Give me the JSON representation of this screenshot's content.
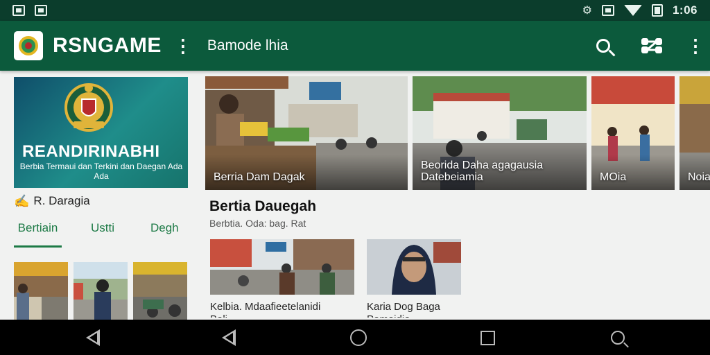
{
  "status_bar": {
    "time": "1:06",
    "left_icons": [
      "gallery-icon",
      "image-icon"
    ],
    "right_icons": [
      "settings-icon",
      "sim-icon",
      "wifi-icon",
      "battery-icon"
    ]
  },
  "app_bar": {
    "title": "RSNGAME",
    "subtitle": "Bamode lhia",
    "icons": [
      "app-logo-icon",
      "more-vert-icon",
      "search-icon",
      "share-icon",
      "more-vert-icon"
    ]
  },
  "sidebar": {
    "banner_title": "REANDIRINABHI",
    "banner_subtitle": "Berbia Termaui dan Terkini dan Daegan Ada Ada",
    "author": "R. Daragia",
    "tabs": [
      {
        "label": "Bertiain",
        "active": true
      },
      {
        "label": "Ustti",
        "active": false
      },
      {
        "label": "Degh",
        "active": false
      }
    ]
  },
  "carousel": [
    {
      "caption": "Berria Dam Dagak"
    },
    {
      "caption": "Beorida Daha agagausia Datebeiamia"
    },
    {
      "caption": "MOia"
    },
    {
      "caption": "Noiaat"
    }
  ],
  "section": {
    "title": "Bertia Dauegah",
    "subtitle": "Berbtia. Oda: bag. Rat",
    "items": [
      {
        "caption": "Kelbia. Mdaafieetelanidi",
        "caption2": "Bali"
      },
      {
        "caption": "Karia Dog Baga",
        "caption2": "Pamaidia"
      }
    ]
  },
  "colors": {
    "status_bar": "#0b3d2c",
    "app_bar": "#0c5a3c",
    "accent": "#1d7a46",
    "nav_bar": "#000000"
  },
  "nav_bar": {
    "buttons": [
      "back-icon",
      "back-icon",
      "home-icon",
      "recents-icon",
      "search-icon"
    ]
  }
}
